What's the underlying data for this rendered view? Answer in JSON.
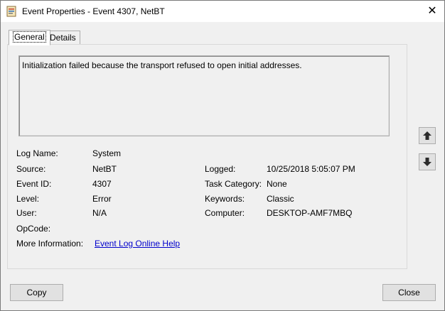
{
  "window": {
    "title": "Event Properties - Event 4307, NetBT",
    "close_glyph": "✕"
  },
  "tabs": [
    {
      "label": "General",
      "active": true
    },
    {
      "label": "Details",
      "active": false
    }
  ],
  "description": "Initialization failed because the transport refused to open initial addresses.",
  "fields": {
    "log_name": {
      "label": "Log Name:",
      "value": "System"
    },
    "source": {
      "label": "Source:",
      "value": "NetBT"
    },
    "event_id": {
      "label": "Event ID:",
      "value": "4307"
    },
    "level": {
      "label": "Level:",
      "value": "Error"
    },
    "user": {
      "label": "User:",
      "value": "N/A"
    },
    "opcode": {
      "label": "OpCode:",
      "value": ""
    },
    "more_info": {
      "label": "More Information:",
      "link": "Event Log Online Help"
    },
    "logged": {
      "label": "Logged:",
      "value": "10/25/2018 5:05:07 PM"
    },
    "task_category": {
      "label": "Task Category:",
      "value": "None"
    },
    "keywords": {
      "label": "Keywords:",
      "value": "Classic"
    },
    "computer": {
      "label": "Computer:",
      "value": "DESKTOP-AMF7MBQ"
    }
  },
  "buttons": {
    "copy": "Copy",
    "close": "Close"
  },
  "icons": {
    "up": "arrow-up-icon",
    "down": "arrow-down-icon"
  }
}
